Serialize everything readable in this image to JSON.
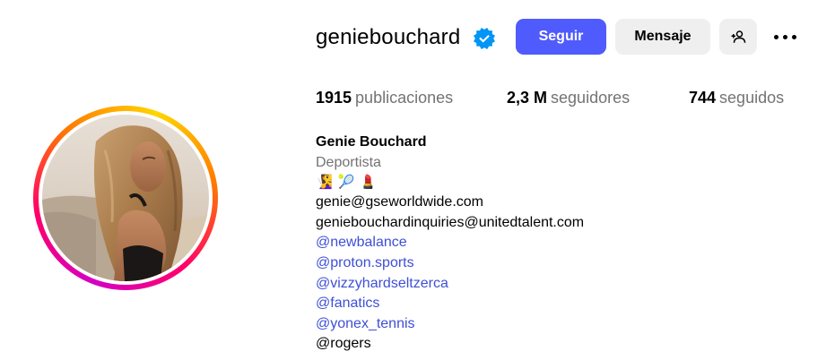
{
  "profile": {
    "username": "geniebouchard",
    "follow_label": "Seguir",
    "message_label": "Mensaje",
    "stats": {
      "posts_count": "1915",
      "posts_label": "publicaciones",
      "followers_count": "2,3 M",
      "followers_label": "seguidores",
      "following_count": "744",
      "following_label": "seguidos"
    },
    "bio": {
      "full_name": "Genie Bouchard",
      "category": "Deportista",
      "emojis": [
        "🧏‍♀️",
        "🎾",
        "💄"
      ],
      "email1": "genie@gseworldwide.com",
      "email2": "geniebouchardinquiries@unitedtalent.com",
      "mentions": [
        "@newbalance",
        "@proton.sports",
        "@vizzyhardseltzerca",
        "@fanatics",
        "@yonex_tennis"
      ],
      "last_line": "@rogers"
    }
  },
  "colors": {
    "accent": "#4f5bfc",
    "verified": "#0095f6",
    "mention": "#3e4fd6",
    "secondary_text": "#737373",
    "button_gray": "#efefef"
  },
  "icons": {
    "verified": "verified-badge-icon",
    "add_user": "add-user-icon",
    "more": "more-options-icon"
  }
}
